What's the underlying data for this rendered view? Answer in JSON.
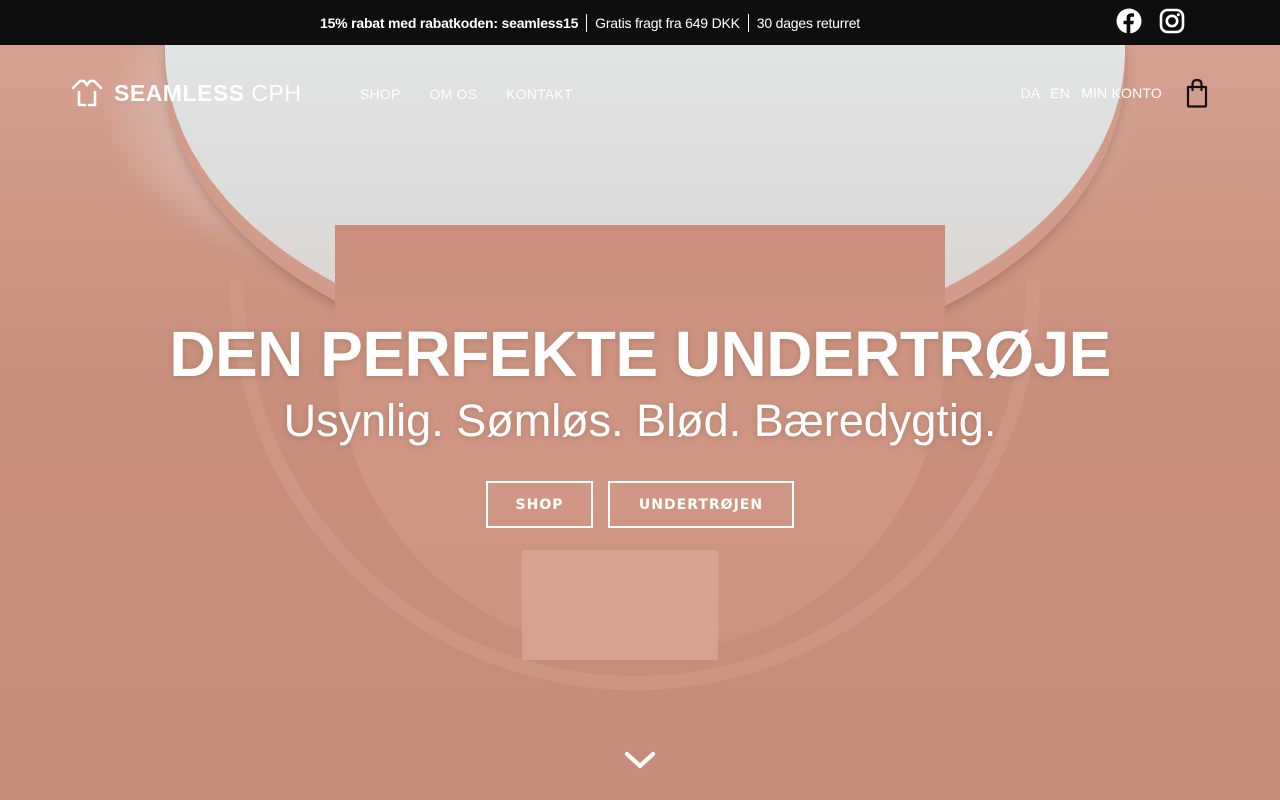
{
  "topbar": {
    "promo_code": "15% rabat med rabatkoden: seamless15",
    "free_shipping": "Gratis fragt fra 649 DKK",
    "returns": "30 dages returret",
    "social": [
      "facebook-icon",
      "instagram-icon"
    ]
  },
  "header": {
    "logo_bold": "SEAMLESS",
    "logo_light": "CPH",
    "nav": [
      "SHOP",
      "OM OS",
      "KONTAKT"
    ],
    "lang_da": "DA",
    "lang_en": "EN",
    "account": "MIN KONTO",
    "cart_icon": "shopping-bag-icon"
  },
  "hero": {
    "headline": "DEN PERFEKTE UNDERTRØJE",
    "subline": "Usynlig. Sømløs. Blød. Bæredygtig.",
    "cta_shop": "SHOP",
    "cta_undershirt": "UNDERTRØJEN",
    "scroll_icon": "chevron-down-icon"
  },
  "colors": {
    "topbar_bg": "#0e0e0e",
    "hero_tone": "#c9937f",
    "text": "#ffffff"
  }
}
